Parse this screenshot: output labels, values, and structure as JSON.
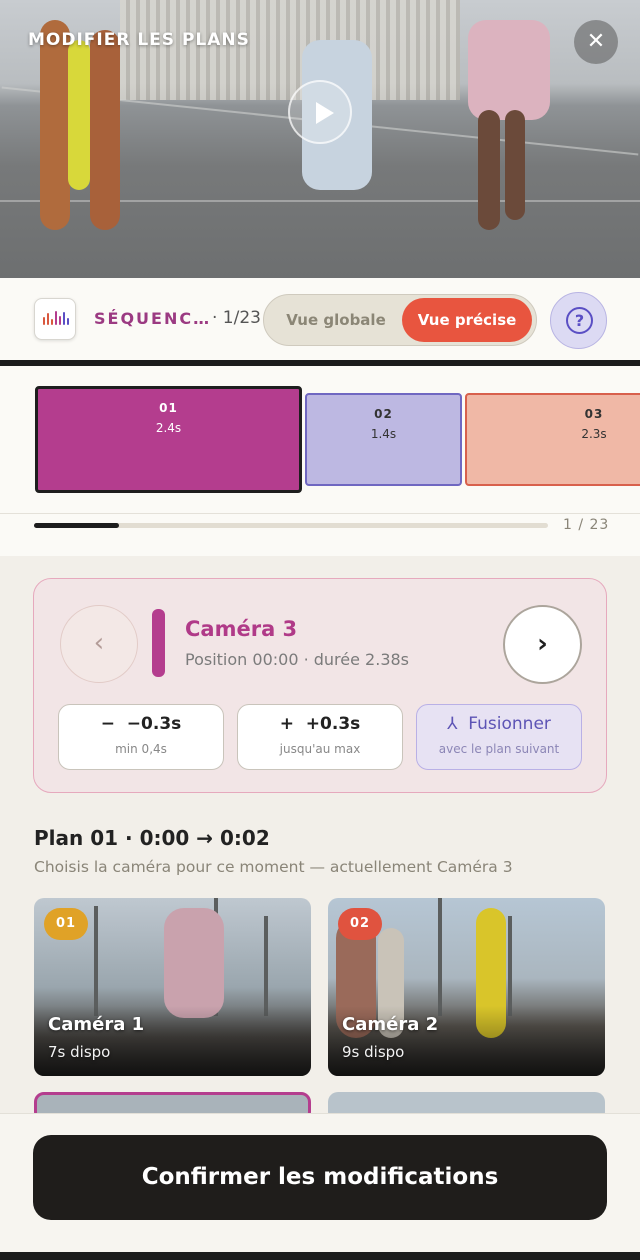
{
  "header": {
    "title": "MODIFIER LES PLANS",
    "close_icon": "close-icon",
    "play_icon": "play-icon"
  },
  "toolbar": {
    "app_icon": "waveform-icon",
    "sequence_label": "SÉQUENC…",
    "sequence_count": "· 1/23",
    "view_global": "Vue globale",
    "view_precise": "Vue précise",
    "help_icon": "help-circle-icon",
    "help_label": "?",
    "accent_color": "#e8553f"
  },
  "timeline": {
    "clips": [
      {
        "number": "01",
        "duration": "2.4s",
        "color": "#b43d8e"
      },
      {
        "number": "02",
        "duration": "1.4s",
        "color": "#bdb8e2"
      },
      {
        "number": "03",
        "duration": "2.3s",
        "color": "#f0b8a6"
      }
    ],
    "progress_label": "1 / 23",
    "progress": 0.165
  },
  "camera_card": {
    "prev_icon": "chevron-left-icon",
    "prev_label": "‹",
    "next_icon": "chevron-right-icon",
    "next_label": "›",
    "title": "Caméra 3",
    "subtitle": "Position 00:00 · durée 2.38s",
    "actions": {
      "minus": {
        "label": "−0.3s",
        "icon": "minus-icon",
        "glyph": "−",
        "sub": "min 0,4s"
      },
      "plus": {
        "label": "+0.3s",
        "icon": "plus-icon",
        "glyph": "+",
        "sub": "jusqu'au max"
      },
      "merge": {
        "label": "Fusionner",
        "icon": "merge-icon",
        "glyph": "⅄",
        "sub": "avec le plan suivant"
      }
    }
  },
  "plan": {
    "title_prefix": "Plan 01 · 0:00",
    "arrow": "→",
    "title_suffix": "0:02",
    "subtitle": "Choisis la caméra pour ce moment — actuellement Caméra 3"
  },
  "cameras": [
    {
      "badge": "01",
      "name": "Caméra 1",
      "available": "7s dispo",
      "badge_color": "#e0a227"
    },
    {
      "badge": "02",
      "name": "Caméra 2",
      "available": "9s dispo",
      "badge_color": "#e0533f"
    }
  ],
  "footer": {
    "confirm_label": "Confirmer les modifications"
  }
}
